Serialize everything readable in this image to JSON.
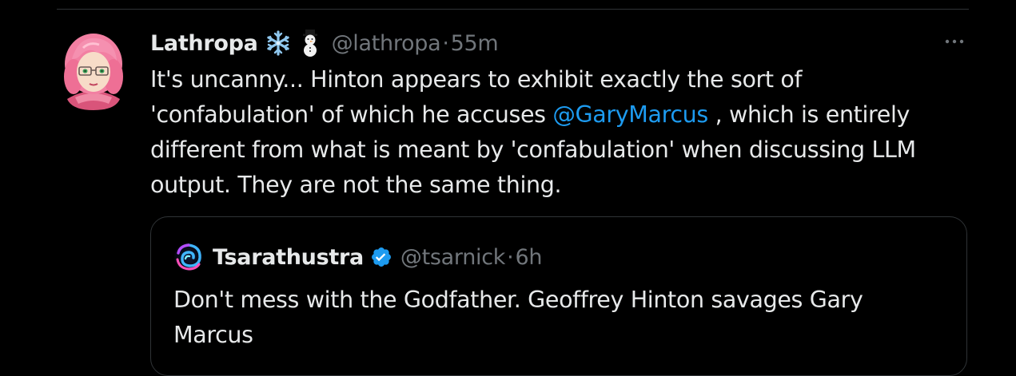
{
  "tweet": {
    "author": {
      "display_name": "Lathropa",
      "name_emojis": [
        "snowflake-icon",
        "snowman-icon"
      ],
      "handle": "@lathropa",
      "time": "55m"
    },
    "more_icon": "ellipsis-icon",
    "text_before": "It's uncanny... Hinton appears to exhibit exactly the sort of 'confabulation' of which he accuses ",
    "mention": "@GaryMarcus",
    "text_after": " , which is entirely different from what is meant by 'confabulation' when discussing LLM output. They are not the same thing.",
    "mention_color": "#1d9bf0"
  },
  "quote": {
    "author": {
      "display_name": "Tsarathustra",
      "verified_icon": "verified-badge-icon",
      "handle": "@tsarnick",
      "time": "6h"
    },
    "text": "Don't mess with the Godfather. Geoffrey Hinton savages Gary Marcus"
  },
  "colors": {
    "background": "#000000",
    "text": "#e7e9ea",
    "secondary_text": "#71767b",
    "border": "#2f3336",
    "accent": "#1d9bf0"
  }
}
